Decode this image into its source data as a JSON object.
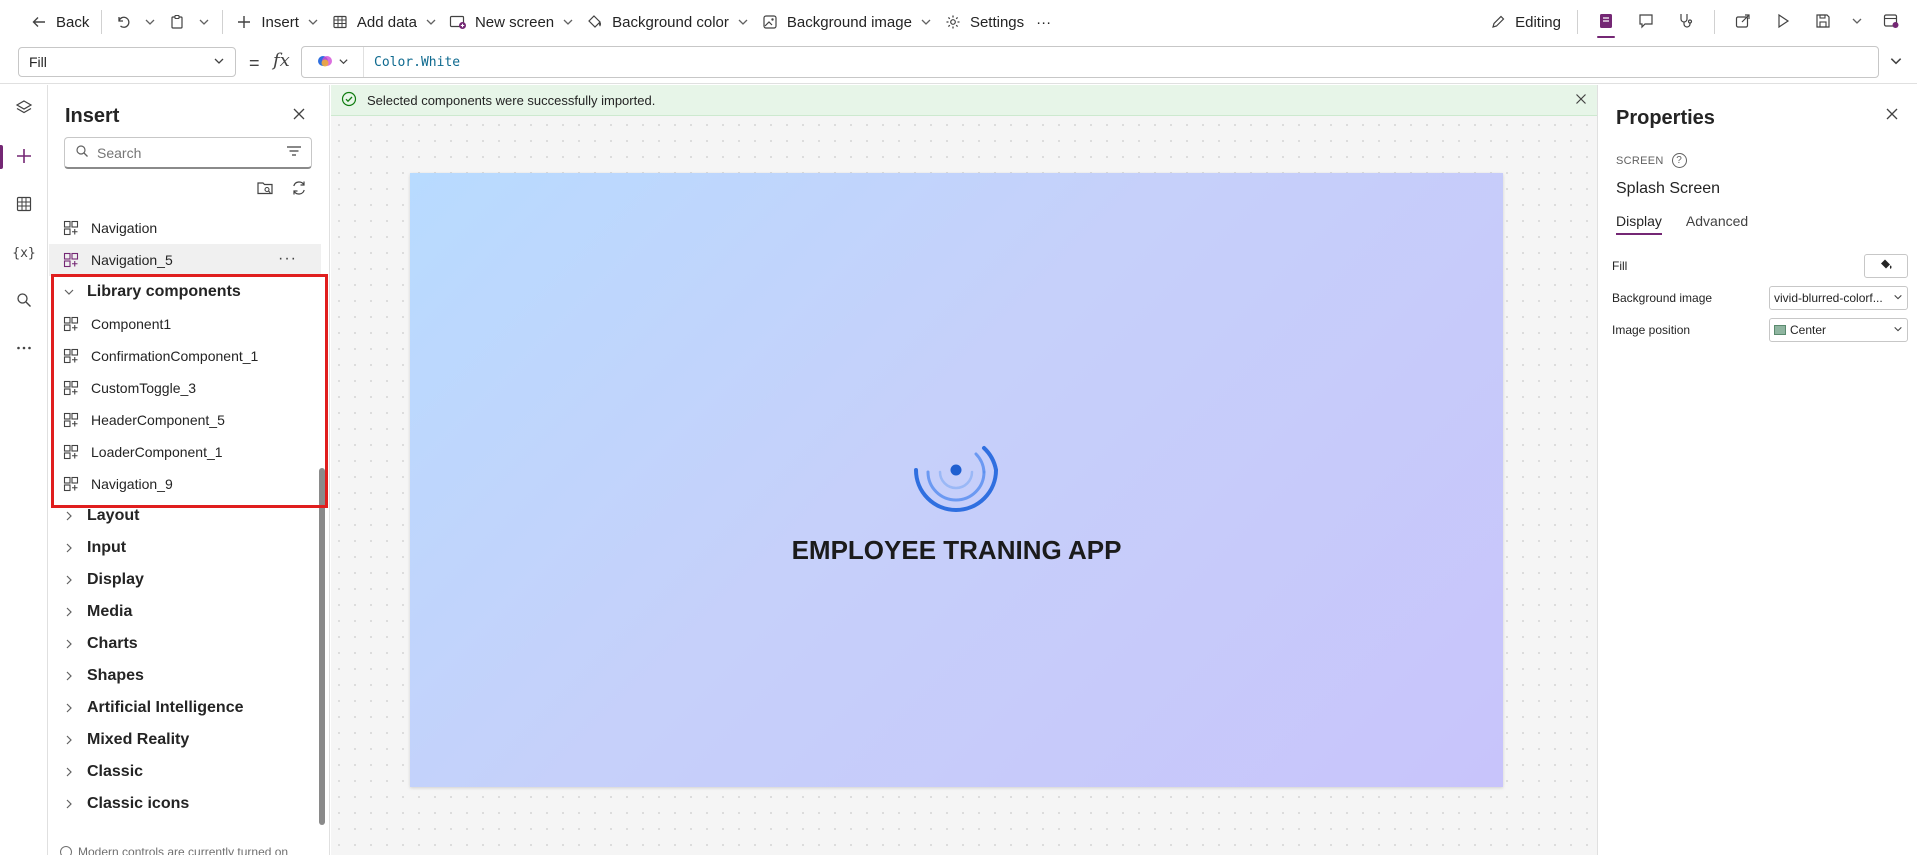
{
  "toolbar": {
    "back_label": "Back",
    "insert_label": "Insert",
    "add_data_label": "Add data",
    "new_screen_label": "New screen",
    "background_color_label": "Background color",
    "background_image_label": "Background image",
    "settings_label": "Settings",
    "more_label": "···",
    "editing_label": "Editing"
  },
  "formula_bar": {
    "property": "Fill",
    "equals": "=",
    "fx": "fx",
    "formula": "Color.White"
  },
  "insert_pane": {
    "title": "Insert",
    "search_placeholder": "Search",
    "items": [
      {
        "label": "Navigation"
      },
      {
        "label": "Navigation_5",
        "more": "···"
      }
    ],
    "library_section": "Library components",
    "library_items": [
      {
        "label": "Component1"
      },
      {
        "label": "ConfirmationComponent_1"
      },
      {
        "label": "CustomToggle_3"
      },
      {
        "label": "HeaderComponent_5"
      },
      {
        "label": "LoaderComponent_1"
      },
      {
        "label": "Navigation_9"
      }
    ],
    "sections": [
      {
        "label": "Layout"
      },
      {
        "label": "Input"
      },
      {
        "label": "Display"
      },
      {
        "label": "Media"
      },
      {
        "label": "Charts"
      },
      {
        "label": "Shapes"
      },
      {
        "label": "Artificial Intelligence"
      },
      {
        "label": "Mixed Reality"
      },
      {
        "label": "Classic"
      },
      {
        "label": "Classic icons"
      }
    ],
    "footer_note": "Modern controls are currently turned on"
  },
  "canvas": {
    "banner_text": "Selected components were successfully imported.",
    "app_title": "EMPLOYEE TRANING APP"
  },
  "properties": {
    "title": "Properties",
    "type_label": "SCREEN",
    "screen_name": "Splash Screen",
    "tabs": [
      "Display",
      "Advanced"
    ],
    "fill_label": "Fill",
    "background_image_label": "Background image",
    "background_image_value": "vivid-blurred-colorf...",
    "image_position_label": "Image position",
    "image_position_value": "Center"
  },
  "colors": {
    "accent": "#742774",
    "highlight": "#e01e1e",
    "banner_bg": "#e7f5e8",
    "spinner": "#2f6fe0"
  }
}
